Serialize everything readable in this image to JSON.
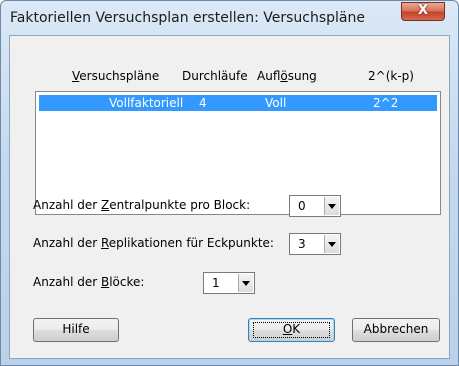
{
  "window": {
    "title": "Faktoriellen Versuchsplan erstellen: Versuchspläne",
    "close_glyph": "X"
  },
  "table": {
    "headers": {
      "plans": {
        "mnemonic": "V",
        "rest": "ersuchspläne"
      },
      "runs": "Durchläufe",
      "resolution": {
        "pre": "Aufl",
        "mnemonic": "ö",
        "rest": "sung"
      },
      "power": "2^(k-p)"
    },
    "rows": [
      {
        "plan": "Vollfaktoriell",
        "runs": "4",
        "resolution": "Voll",
        "power": "2^2",
        "selected": true
      }
    ]
  },
  "fields": {
    "center_points": {
      "pre": "Anzahl der ",
      "mnemonic": "Z",
      "rest": "entralpunkte pro Block:",
      "value": "0"
    },
    "replications": {
      "pre": "Anzahl der ",
      "mnemonic": "R",
      "rest": "eplikationen für Eckpunkte:",
      "value": "3"
    },
    "blocks": {
      "pre": "Anzahl der ",
      "mnemonic": "B",
      "rest": "löcke:",
      "value": "1"
    }
  },
  "buttons": {
    "help": "Hilfe",
    "ok": {
      "mnemonic": "O",
      "rest": "K"
    },
    "cancel": "Abbrechen"
  }
}
